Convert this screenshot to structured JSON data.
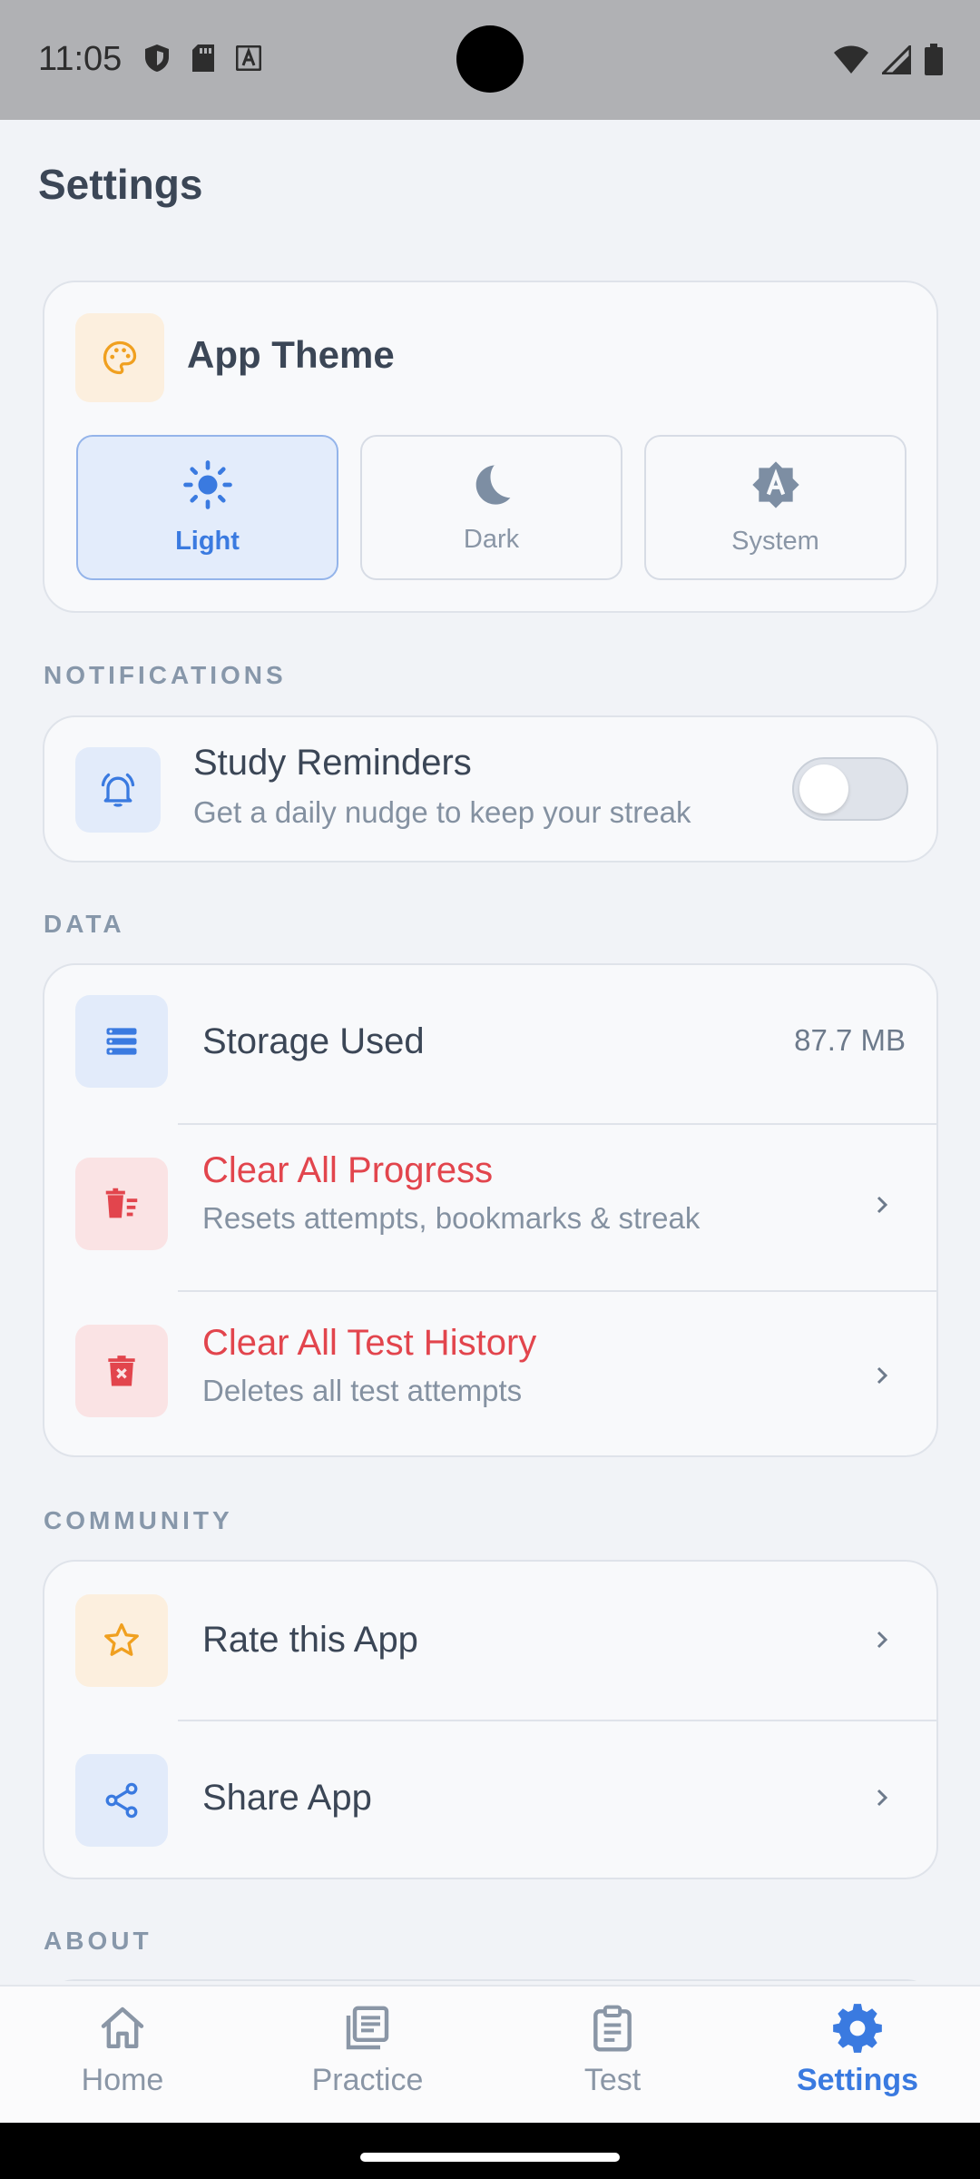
{
  "status_bar": {
    "time": "11:05"
  },
  "page": {
    "title": "Settings"
  },
  "theme": {
    "title": "App Theme",
    "options": [
      {
        "label": "Light",
        "selected": true
      },
      {
        "label": "Dark",
        "selected": false
      },
      {
        "label": "System",
        "selected": false
      }
    ]
  },
  "sections": {
    "notifications": "NOTIFICATIONS",
    "data": "DATA",
    "community": "COMMUNITY",
    "about": "ABOUT"
  },
  "notifications": {
    "reminders_title": "Study Reminders",
    "reminders_sub": "Get a daily nudge to keep your streak",
    "reminders_enabled": false
  },
  "data": {
    "storage_title": "Storage Used",
    "storage_value": "87.7 MB",
    "clear_progress_title": "Clear All Progress",
    "clear_progress_sub": "Resets attempts, bookmarks & streak",
    "clear_history_title": "Clear All Test History",
    "clear_history_sub": "Deletes all test attempts"
  },
  "community": {
    "rate_title": "Rate this App",
    "share_title": "Share App"
  },
  "nav": {
    "items": [
      {
        "label": "Home",
        "active": false
      },
      {
        "label": "Practice",
        "active": false
      },
      {
        "label": "Test",
        "active": false
      },
      {
        "label": "Settings",
        "active": true
      }
    ]
  },
  "colors": {
    "accent": "#3a7ae0",
    "danger": "#e2454d",
    "orange": "#f0a020"
  }
}
